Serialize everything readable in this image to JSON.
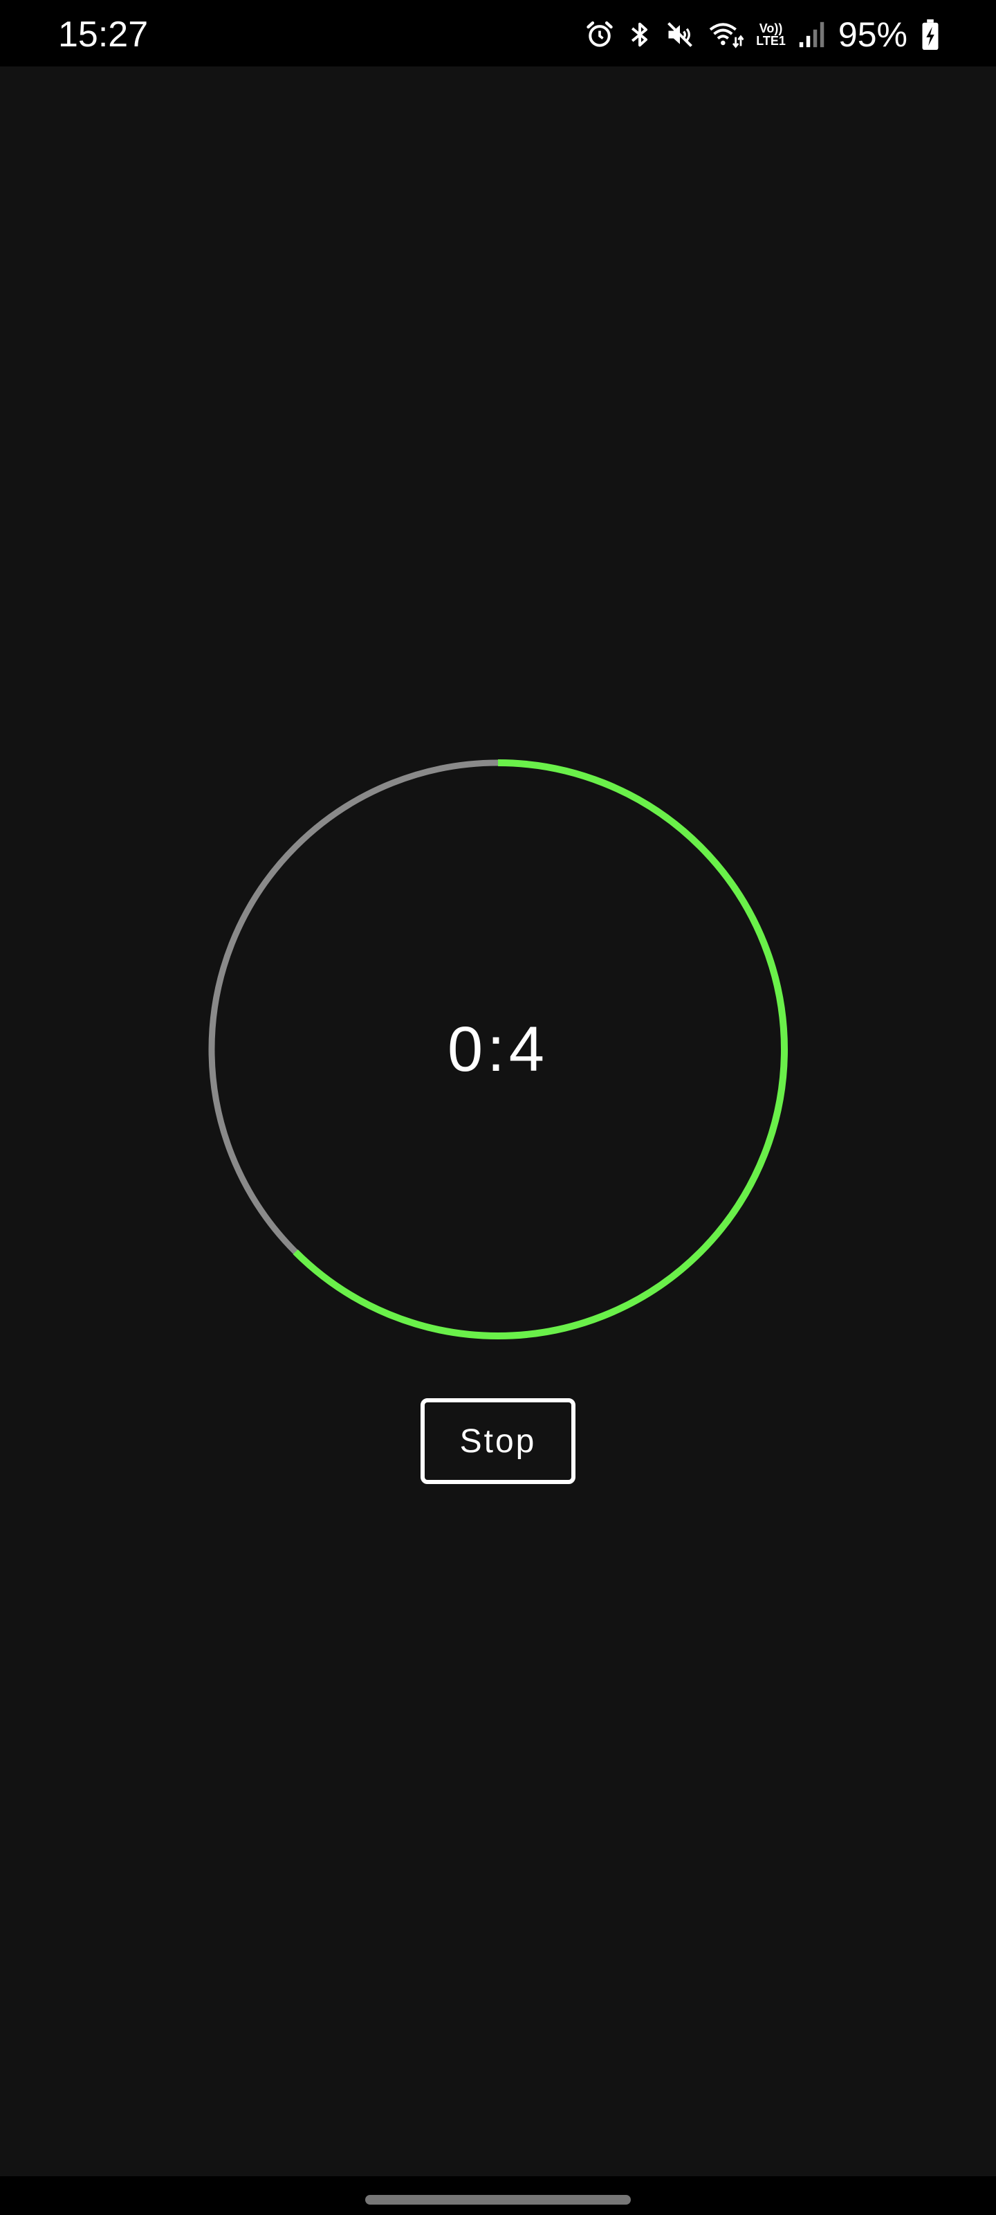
{
  "status_bar": {
    "time": "15:27",
    "volte_top": "Vo))",
    "volte_bottom": "LTE1",
    "battery_percent": "95%",
    "icons": [
      "alarm-icon",
      "bluetooth-icon",
      "mute-icon",
      "wifi-icon",
      "volte-icon",
      "signal-icon",
      "battery-charging-icon"
    ]
  },
  "timer": {
    "display": "0:4",
    "progress_fraction": 0.625,
    "progress_color": "#6af04a",
    "track_color": "#8a8a8a"
  },
  "controls": {
    "stop_label": "Stop"
  },
  "colors": {
    "background": "#121212",
    "status_bar": "#000000"
  }
}
